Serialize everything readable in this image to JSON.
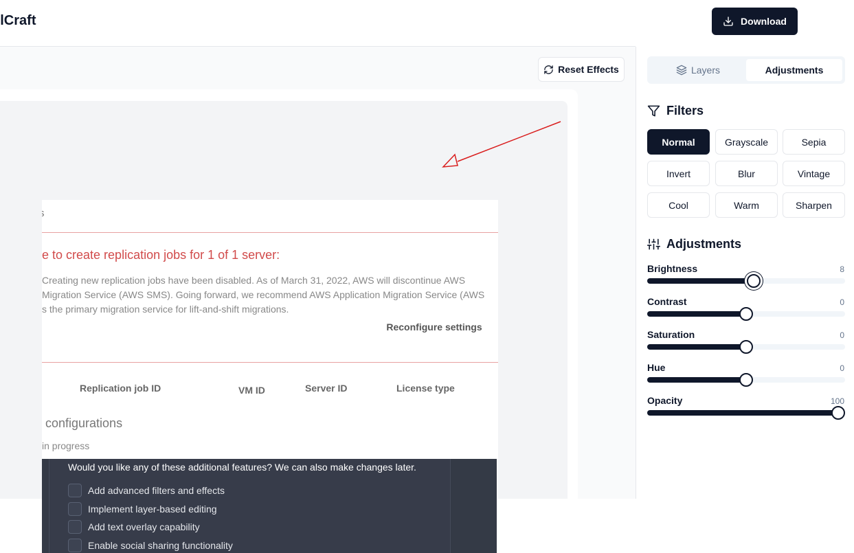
{
  "app": {
    "title": "xelCraft"
  },
  "header": {
    "download_label": "Download"
  },
  "toolbar": {
    "reset_label": "Reset Effects"
  },
  "screenshot": {
    "pre_title": "s",
    "error_title": "e to create replication jobs for 1 of 1 server:",
    "error_body": [
      "Creating new replication jobs have been disabled. As of March 31, 2022, AWS will discontinue AWS",
      "Migration Service (AWS SMS). Going forward, we recommend AWS Application Migration Service (AWS",
      "s the primary migration service for lift-and-shift migrations."
    ],
    "reconfigure_label": "Reconfigure settings",
    "columns": [
      "Replication job ID",
      "VM ID",
      "Server ID",
      "License type"
    ],
    "configs_heading": "configurations",
    "in_progress": "in progress",
    "dialog": {
      "question": "Would you like any of these additional features? We can also make changes later.",
      "options": [
        "Add advanced filters and effects",
        "Implement layer-based editing",
        "Add text overlay capability",
        "Enable social sharing functionality"
      ]
    }
  },
  "sidebar": {
    "tabs": [
      {
        "label": "Layers",
        "icon": "layers-icon",
        "active": false
      },
      {
        "label": "Adjustments",
        "icon": "",
        "active": true
      }
    ],
    "filters_title": "Filters",
    "filters": [
      "Normal",
      "Grayscale",
      "Sepia",
      "Invert",
      "Blur",
      "Vintage",
      "Cool",
      "Warm",
      "Sharpen"
    ],
    "active_filter": "Normal",
    "adjustments_title": "Adjustments",
    "sliders": [
      {
        "label": "Brightness",
        "value": "8",
        "fraction": 0.54
      },
      {
        "label": "Contrast",
        "value": "0",
        "fraction": 0.5
      },
      {
        "label": "Saturation",
        "value": "0",
        "fraction": 0.5
      },
      {
        "label": "Hue",
        "value": "0",
        "fraction": 0.5
      },
      {
        "label": "Opacity",
        "value": "100",
        "fraction": 1.0
      }
    ]
  },
  "colors": {
    "primary": "#0f172a",
    "error": "#d14a4a",
    "annotation_arrow": "#d91c1c"
  }
}
